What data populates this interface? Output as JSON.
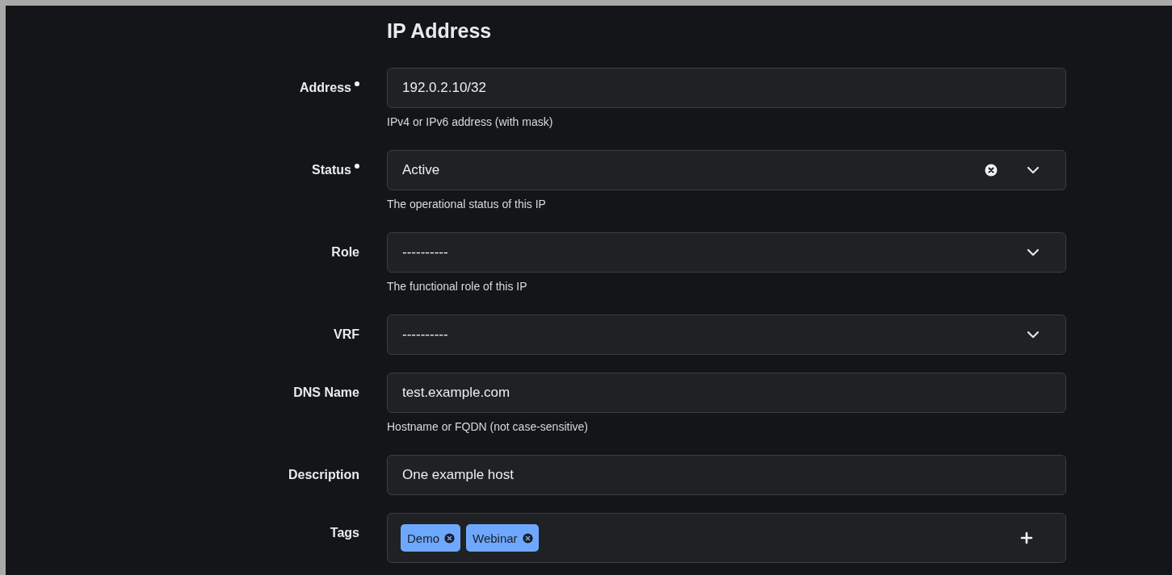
{
  "heading": "IP Address",
  "fields": [
    {
      "kind": "text",
      "label": "Address",
      "required": true,
      "value": "192.0.2.10/32",
      "help": "IPv4 or IPv6 address (with mask)"
    },
    {
      "kind": "select",
      "label": "Status",
      "required": true,
      "value": "Active",
      "clearable": true,
      "help": "The operational status of this IP"
    },
    {
      "kind": "select",
      "label": "Role",
      "required": false,
      "value": "----------",
      "clearable": false,
      "help": "The functional role of this IP"
    },
    {
      "kind": "select",
      "label": "VRF",
      "required": false,
      "value": "----------",
      "clearable": false
    },
    {
      "kind": "text",
      "label": "DNS Name",
      "required": false,
      "value": "test.example.com",
      "help": "Hostname or FQDN (not case-sensitive)"
    },
    {
      "kind": "text",
      "label": "Description",
      "required": false,
      "value": "One example host"
    },
    {
      "kind": "tags",
      "label": "Tags",
      "required": false,
      "tags": [
        "Demo",
        "Webinar"
      ]
    }
  ]
}
